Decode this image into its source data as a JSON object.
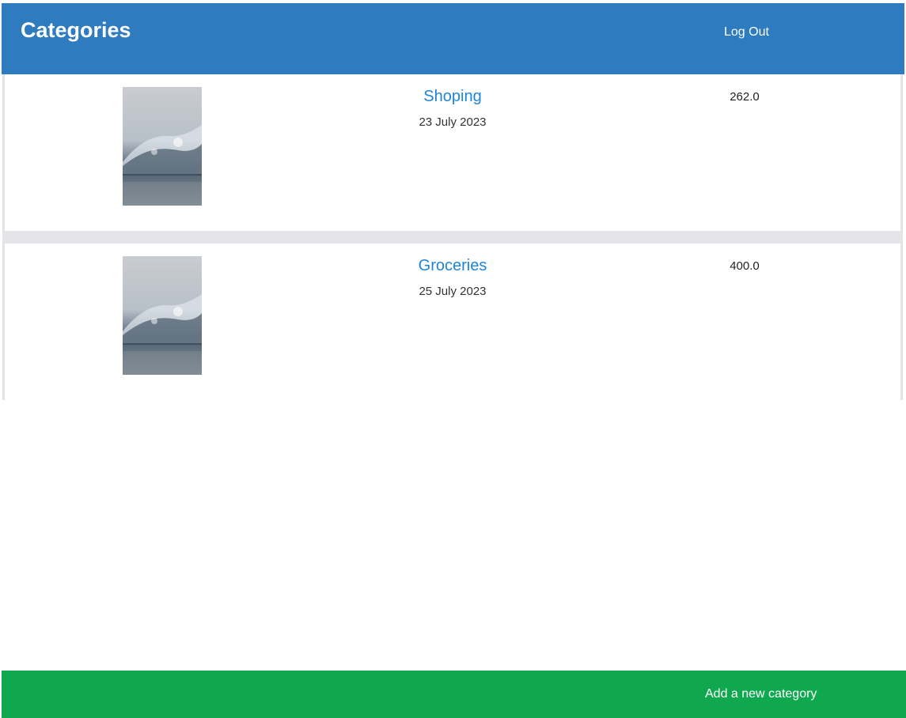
{
  "header": {
    "title": "Categories",
    "logout_label": "Log Out",
    "color": "#2e7bc0"
  },
  "categories": [
    {
      "name": "Shoping",
      "date": "23 July 2023",
      "amount": "262.0",
      "icon": "water-splash-image"
    },
    {
      "name": "Groceries",
      "date": "25 July 2023",
      "amount": "400.0",
      "icon": "water-splash-image"
    }
  ],
  "footer": {
    "add_label": "Add a new category",
    "color": "#10a84f"
  },
  "colors": {
    "link": "#1e84d6",
    "separator": "#e4e4e8"
  }
}
